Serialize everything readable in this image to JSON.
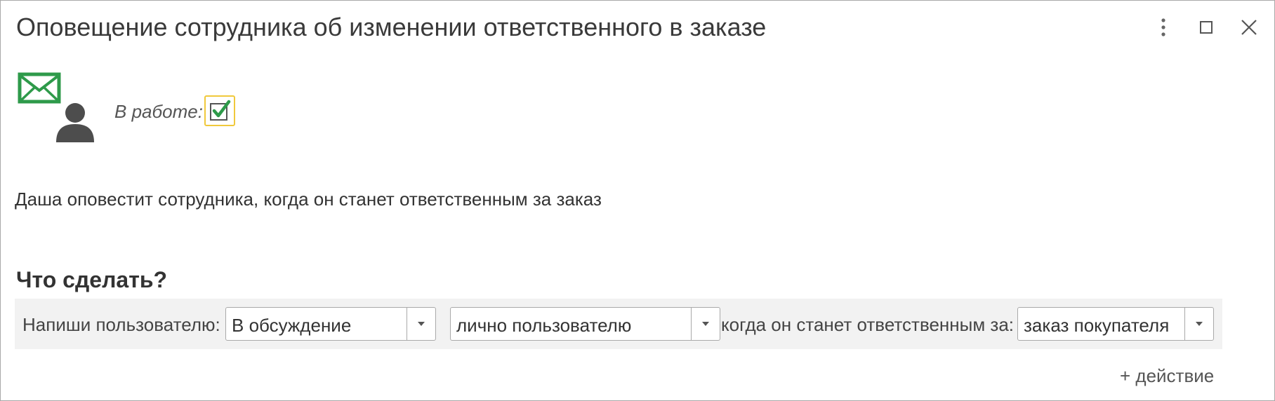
{
  "window": {
    "title": "Оповещение сотрудника об изменении ответственного в заказе"
  },
  "header": {
    "status_label": "В работе:",
    "status_checked": true,
    "icon": "envelope-person-icon"
  },
  "description": "Даша оповестит сотрудника, когда он станет ответственным за заказ",
  "what_to_do": {
    "title": "Что сделать?",
    "action": {
      "label_write": "Напиши пользователю:",
      "channel": "В обсуждение",
      "recipient": "лично пользователю",
      "label_when": "когда он станет ответственным за:",
      "object": "заказ покупателя"
    },
    "add_action_label": "+ действие"
  },
  "colors": {
    "checkbox_border": "#f0c93c",
    "check_mark": "#2e9a4a",
    "envelope": "#2e9a4a",
    "person": "#4d4d4d"
  }
}
